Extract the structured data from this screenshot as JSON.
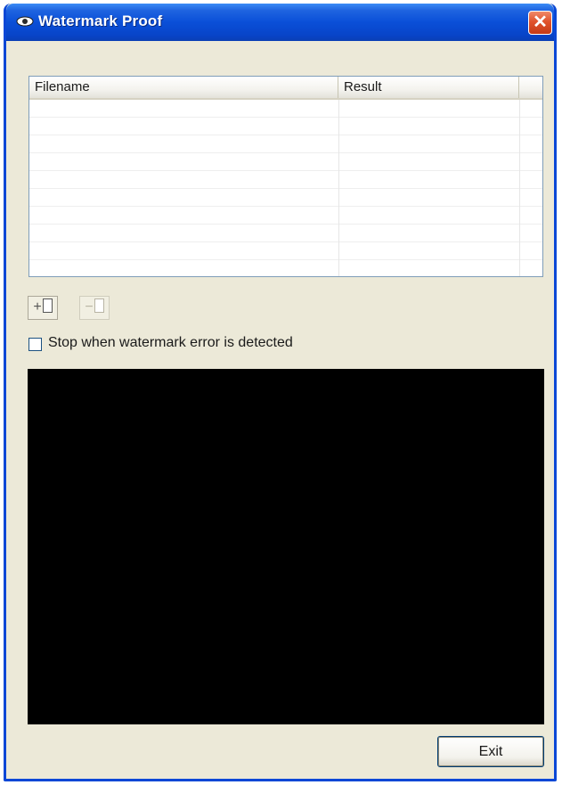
{
  "window": {
    "title": "Watermark Proof",
    "close_symbol": "✕"
  },
  "file_list": {
    "columns": [
      "Filename",
      "Result",
      ""
    ],
    "rows": []
  },
  "toolbar": {
    "add_icon": "add-file-icon",
    "remove_icon": "remove-file-icon"
  },
  "options": {
    "stop_on_error_label": "Stop when watermark error is detected",
    "stop_on_error_checked": false
  },
  "footer": {
    "exit_label": "Exit"
  }
}
